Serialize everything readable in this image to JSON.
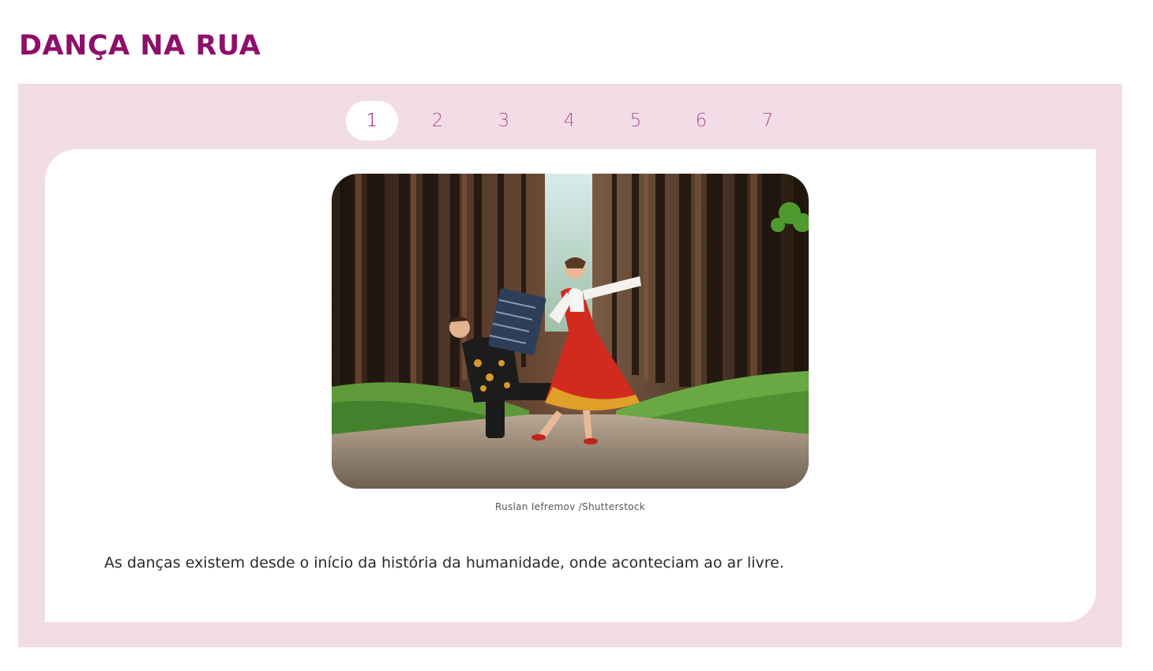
{
  "page": {
    "title": "DANÇA NA RUA"
  },
  "pager": {
    "pages": [
      "1",
      "2",
      "3",
      "4",
      "5",
      "6",
      "7"
    ],
    "active_index": 0
  },
  "slide": {
    "image_alt": "Casal dançando em trajes tradicionais numa estrada de floresta, homem com acordeão",
    "image_credit": "Ruslan Iefremov /Shutterstock",
    "text": "As danças existem desde o início da história da humanidade, onde aconteciam ao ar livre."
  },
  "colors": {
    "title": "#8e0f6a",
    "panel_bg": "#f2dde7",
    "pager_text": "#b04f8c"
  }
}
